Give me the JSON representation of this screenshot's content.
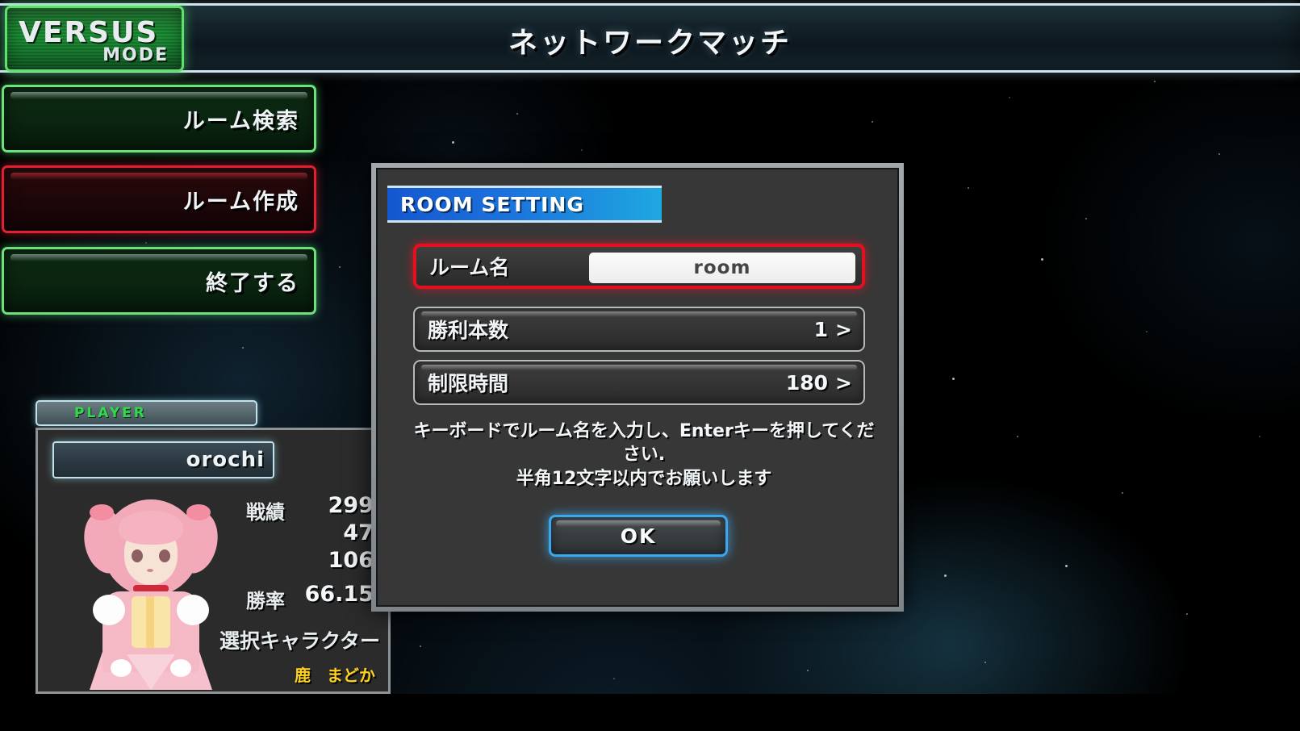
{
  "header": {
    "title": "ネットワークマッチ",
    "logo_main": "VERSUS",
    "logo_sub": "MODE"
  },
  "menu": {
    "items": [
      {
        "label": "ルーム検索",
        "state": "normal"
      },
      {
        "label": "ルーム作成",
        "state": "selected"
      },
      {
        "label": "終了する",
        "state": "normal"
      }
    ]
  },
  "player_panel": {
    "tab_label": "PLAYER",
    "name": "orochi",
    "record_label": "戦績",
    "record_values": [
      "299",
      "47",
      "106"
    ],
    "winrate_label": "勝率",
    "winrate_value": "66.15",
    "character_label": "選択キャラクター",
    "character_name": "鹿　まどか"
  },
  "dialog": {
    "title": "ROOM SETTING",
    "room_name_label": "ルーム名",
    "room_name_value": "room",
    "rounds_label": "勝利本数",
    "rounds_value": "1",
    "rounds_chevron": ">",
    "time_label": "制限時間",
    "time_value": "180",
    "time_chevron": ">",
    "hint_line1": "キーボードでルーム名を入力し、Enterキーを押してくだ",
    "hint_line2": "さい.",
    "hint_line3": "半角12文字以内でお願いします",
    "ok_label": "OK"
  },
  "colors": {
    "accent_green": "#6ce07a",
    "accent_red": "#e02030",
    "accent_blue": "#3aa8f0",
    "title_blue": "#1c73dd",
    "char_yellow": "#ffd21e"
  }
}
